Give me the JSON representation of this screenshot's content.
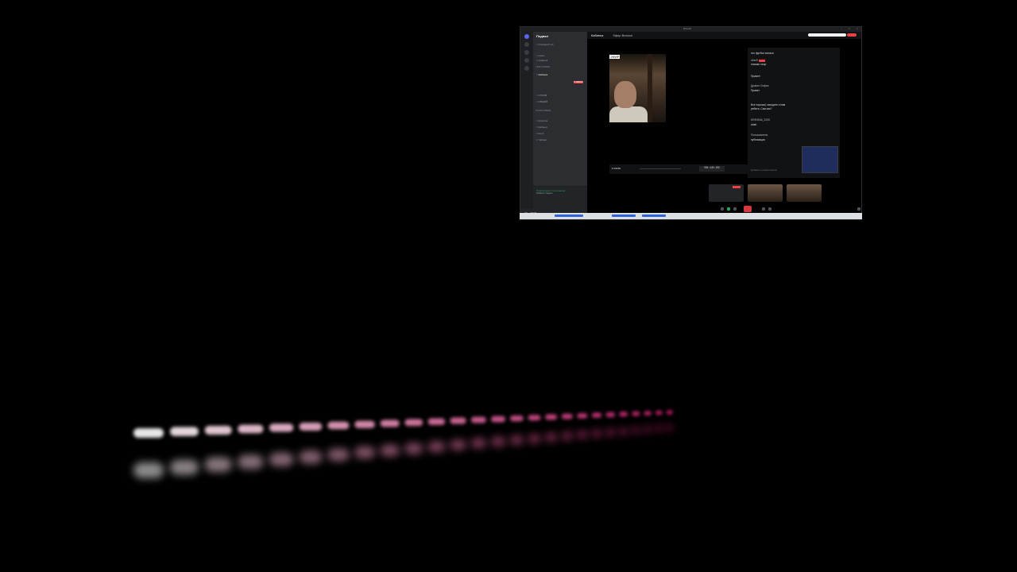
{
  "window": {
    "title": "Discord",
    "server_name": "Подвал",
    "channel_title": "Кабинка",
    "channel_topic": "Эфир Витаса"
  },
  "channels": [
    "Основной чат",
    "мемы",
    "правила",
    "Кабинка",
    "СТРИМ",
    "ОБЩИЙ",
    "Курилка",
    "Кабинет",
    "Клуб",
    "Чайная"
  ],
  "categories": [
    "Текстовые",
    "Голосовые"
  ],
  "user": {
    "name": "vitas9",
    "status": "В сети"
  },
  "voice": {
    "title": "Подключено к голосовому",
    "sub": "Кабинка / Подвал"
  },
  "stream": {
    "time": "00:10:29",
    "live_label": "В ЭФИРЕ",
    "camera_label": "ЭФИР"
  },
  "chat": {
    "messages": [
      {
        "user": "",
        "text": "это футбол витаса"
      },
      {
        "user": "vitas9",
        "text": "покажи лицо"
      },
      {
        "user": "",
        "text": "Привет!"
      },
      {
        "user": "Дракон Софья",
        "text": "Привет"
      },
      {
        "user": "",
        "text": "Все хорошо) заходите к нам"
      },
      {
        "user": "",
        "text": "ребята. Сам как?"
      },
      {
        "user": "KRISHNA_2205",
        "text": "ahah"
      },
      {
        "user": "Пользователь",
        "text": "публикация"
      }
    ],
    "placeholder": "Добавить комментарий"
  },
  "colors": {
    "accent": "#5865f2",
    "live": "#ed4245",
    "online": "#23a55a"
  }
}
